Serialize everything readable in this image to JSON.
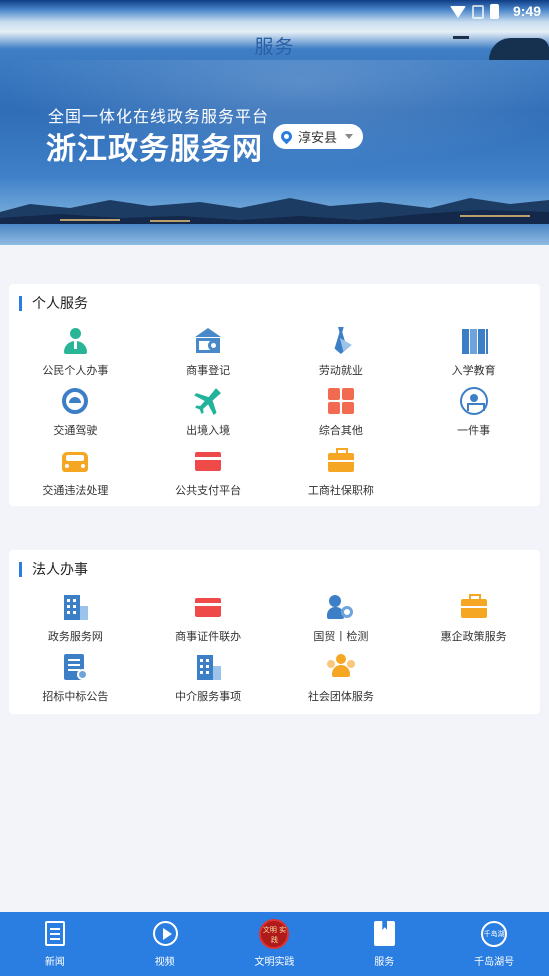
{
  "status_bar": {
    "time": "9:49"
  },
  "header": {
    "title": "服务"
  },
  "banner": {
    "subtitle": "全国一体化在线政务服务平台",
    "title": "浙江政务服务网",
    "location": "淳安县"
  },
  "personal": {
    "section_title": "个人服务",
    "items": [
      {
        "label": "公民个人办事",
        "icon": "person-icon"
      },
      {
        "label": "商事登记",
        "icon": "bank-search-icon"
      },
      {
        "label": "劳动就业",
        "icon": "tie-icon"
      },
      {
        "label": "入学教育",
        "icon": "books-icon"
      },
      {
        "label": "交通驾驶",
        "icon": "steering-wheel-icon"
      },
      {
        "label": "出境入境",
        "icon": "airplane-icon"
      },
      {
        "label": "综合其他",
        "icon": "grid-tiles-icon"
      },
      {
        "label": "一件事",
        "icon": "network-icon"
      },
      {
        "label": "交通违法处理",
        "icon": "car-icon"
      },
      {
        "label": "公共支付平台",
        "icon": "card-icon"
      },
      {
        "label": "工商社保职称",
        "icon": "briefcase-icon"
      }
    ]
  },
  "legal": {
    "section_title": "法人办事",
    "items": [
      {
        "label": "政务服务网",
        "icon": "building-icon"
      },
      {
        "label": "商事证件联办",
        "icon": "card-icon"
      },
      {
        "label": "国贸丨检测",
        "icon": "person-search-icon"
      },
      {
        "label": "惠企政策服务",
        "icon": "briefcase-icon"
      },
      {
        "label": "招标中标公告",
        "icon": "document-icon"
      },
      {
        "label": "中介服务事项",
        "icon": "building-icon"
      },
      {
        "label": "社会团体服务",
        "icon": "group-icon"
      }
    ]
  },
  "tabbar": {
    "tabs": [
      {
        "label": "新闻",
        "icon": "news-icon"
      },
      {
        "label": "视频",
        "icon": "play-icon"
      },
      {
        "label": "文明实践",
        "icon": "civilization-seal-icon",
        "seal_text": "文明 实践"
      },
      {
        "label": "服务",
        "icon": "bookmark-icon",
        "active": true
      },
      {
        "label": "千岛湖号",
        "icon": "qiandaohu-logo-icon",
        "logo_text": "千岛湖"
      }
    ]
  },
  "colors": {
    "primary": "#2a7de1",
    "accent_green": "#23b39a",
    "accent_red": "#ef4a4a",
    "accent_orange": "#f5a623"
  }
}
